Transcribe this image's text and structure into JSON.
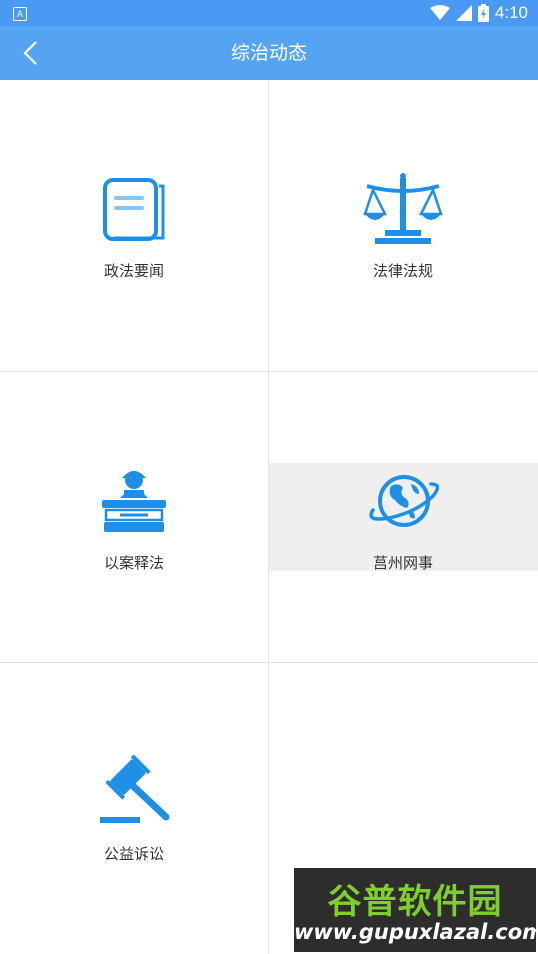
{
  "status_bar": {
    "time": "4:10",
    "app_badge": "A",
    "icons": [
      "wifi-icon",
      "signal-icon",
      "battery-icon"
    ]
  },
  "app_bar": {
    "title": "综治动态",
    "back_icon": "chevron-left-icon"
  },
  "menu": {
    "items": [
      {
        "label": "政法要闻",
        "icon": "document-icon"
      },
      {
        "label": "法律法规",
        "icon": "scales-icon"
      },
      {
        "label": "以案释法",
        "icon": "judge-podium-icon"
      },
      {
        "label": "莒州网事",
        "icon": "globe-icon"
      },
      {
        "label": "公益诉讼",
        "icon": "gavel-icon"
      }
    ]
  },
  "watermark": {
    "brand": "谷普软件园",
    "url": "www.gupuxlazal.com"
  },
  "colors": {
    "app_bar": "#55a4f4",
    "status_bar": "#4a9af3",
    "icon": "#1e8fe6",
    "pressed_cell": "#efefef",
    "divider": "#e4e4e4"
  }
}
